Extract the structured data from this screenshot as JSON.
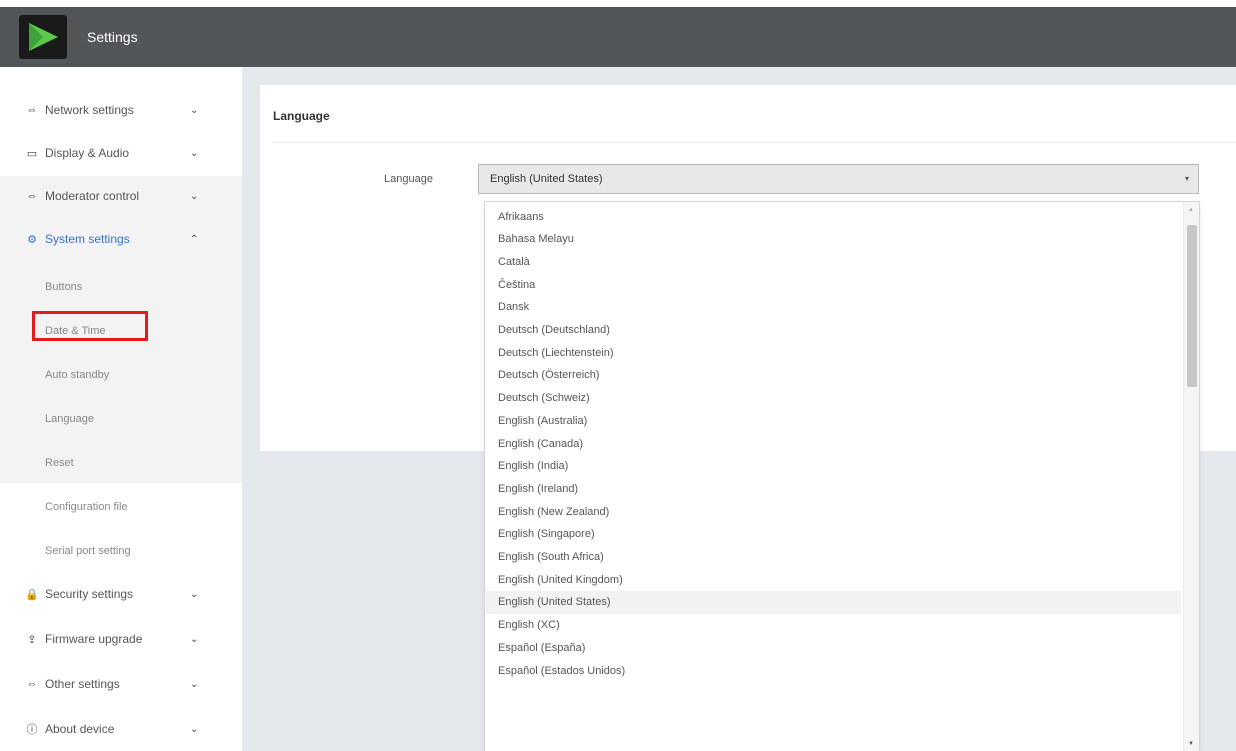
{
  "app": {
    "title": "Settings",
    "logo_icon": "play-logo-icon"
  },
  "sidebar": {
    "items": [
      {
        "label": "Network settings",
        "icon": "network-icon",
        "glyph": "⇔",
        "chevron": "⌄",
        "active": false
      },
      {
        "label": "Display & Audio",
        "icon": "monitor-icon",
        "glyph": "▭",
        "chevron": "⌄",
        "active": false
      },
      {
        "label": "Moderator control",
        "icon": "moderator-icon",
        "glyph": "⇔",
        "chevron": "⌄",
        "active": false
      },
      {
        "label": "System settings",
        "icon": "gear-icon",
        "glyph": "⚙",
        "chevron": "⌃",
        "active": true
      }
    ],
    "sub_items": [
      {
        "label": "Buttons"
      },
      {
        "label": "Date & Time"
      },
      {
        "label": "Auto standby"
      },
      {
        "label": "Language",
        "highlighted": true
      },
      {
        "label": "Reset"
      },
      {
        "label": "Configuration file"
      },
      {
        "label": "Serial port setting"
      }
    ],
    "items_bottom": [
      {
        "label": "Security settings",
        "icon": "lock-icon",
        "glyph": "🔒",
        "chevron": "⌄"
      },
      {
        "label": "Firmware upgrade",
        "icon": "upload-icon",
        "glyph": "⇪",
        "chevron": "⌄"
      },
      {
        "label": "Other settings",
        "icon": "other-settings-icon",
        "glyph": "⇔",
        "chevron": "⌄"
      },
      {
        "label": "About device",
        "icon": "info-icon",
        "glyph": "ⓘ",
        "chevron": "⌄"
      }
    ]
  },
  "main": {
    "section_title": "Language",
    "field_label": "Language",
    "select": {
      "value": "English (United States)",
      "arrow": "▾",
      "options": [
        "Afrikaans",
        "Bahasa Melayu",
        "Català",
        "Čeština",
        "Dansk",
        "Deutsch (Deutschland)",
        "Deutsch (Liechtenstein)",
        "Deutsch (Österreich)",
        "Deutsch (Schweiz)",
        "English (Australia)",
        "English (Canada)",
        "English (India)",
        "English (Ireland)",
        "English (New Zealand)",
        "English (Singapore)",
        "English (South Africa)",
        "English (United Kingdom)",
        "English (United States)",
        "English (XC)",
        "Español (España)",
        "Español (Estados Unidos)"
      ],
      "selected_index": 17,
      "scroll_up": "▲",
      "scroll_down": "▼"
    }
  },
  "colors": {
    "topbar": "#535659",
    "accent": "#3a6fc4",
    "highlight_box": "#e21b1b",
    "logo_green": "#5cc94a"
  }
}
